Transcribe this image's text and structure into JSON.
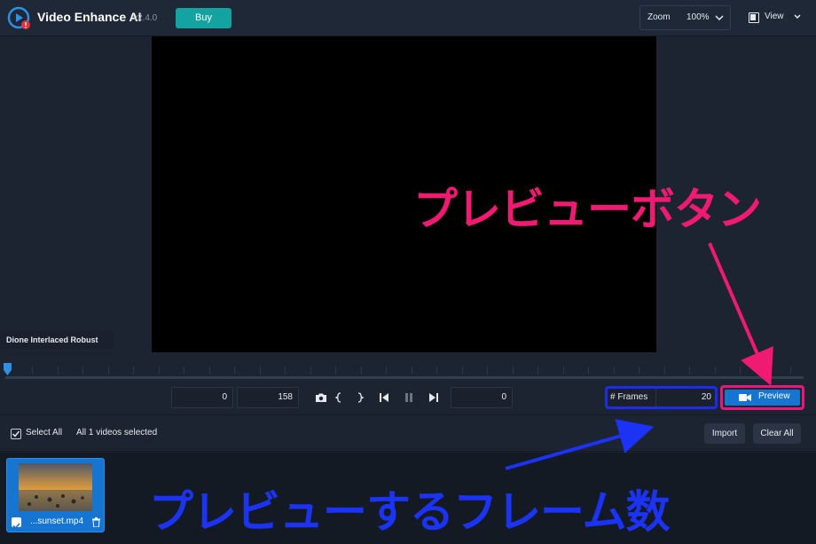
{
  "app": {
    "title": "Video Enhance AI",
    "version": "v2.4.0",
    "buy_label": "Buy"
  },
  "toolbar": {
    "zoom_label": "Zoom",
    "zoom_value": "100%",
    "view_label": "View"
  },
  "preview": {
    "model_label": "Dione Interlaced Robust"
  },
  "controls": {
    "start_frame": "0",
    "end_frame": "158",
    "current_frame": "0",
    "frames_label": "# Frames",
    "frames_value": "20",
    "preview_label": "Preview"
  },
  "selection": {
    "select_all_label": "Select All",
    "selected_count": "All 1 videos selected",
    "import_label": "Import",
    "clear_all_label": "Clear All"
  },
  "videos": [
    {
      "name": "...sunset.mp4",
      "checked": true
    }
  ],
  "annotations": {
    "preview_button": "プレビューボタン",
    "frames_count": "プレビューするフレーム数",
    "colors": {
      "preview": "#f01a72",
      "frames": "#1b33f5"
    }
  },
  "colors": {
    "accent": "#1675d1",
    "buy": "#14a3a0",
    "background": "#1c2431"
  }
}
